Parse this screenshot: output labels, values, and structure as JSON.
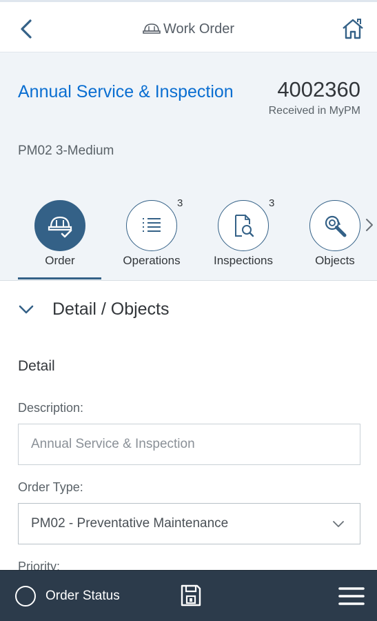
{
  "topbar": {
    "title": "Work Order",
    "back_icon": "chevron-left-icon",
    "title_icon": "hardhat-icon",
    "home_icon": "home-icon"
  },
  "header": {
    "title": "Annual Service & Inspection",
    "number": "4002360",
    "status": "Received in MyPM",
    "priority": "PM02 3-Medium"
  },
  "tabs": [
    {
      "label": "Order",
      "count": "",
      "icon": "hardhat-check-icon",
      "active": true
    },
    {
      "label": "Operations",
      "count": "3",
      "icon": "list-icon",
      "active": false
    },
    {
      "label": "Inspections",
      "count": "3",
      "icon": "inspect-document-icon",
      "active": false
    },
    {
      "label": "Objects",
      "count": "",
      "icon": "object-search-icon",
      "active": false
    }
  ],
  "section": {
    "title": "Detail / Objects",
    "subtitle": "Detail"
  },
  "fields": {
    "description_label": "Description:",
    "description_value": "Annual Service & Inspection",
    "order_type_label": "Order Type:",
    "order_type_value": "PM02 - Preventative Maintenance",
    "priority_label": "Priority:"
  },
  "bottombar": {
    "status_label": "Order Status"
  },
  "colors": {
    "accent": "#346187",
    "link": "#0a6ed1",
    "header_bg": "#f0f4f8",
    "footer_bg": "#2c3b4b"
  }
}
